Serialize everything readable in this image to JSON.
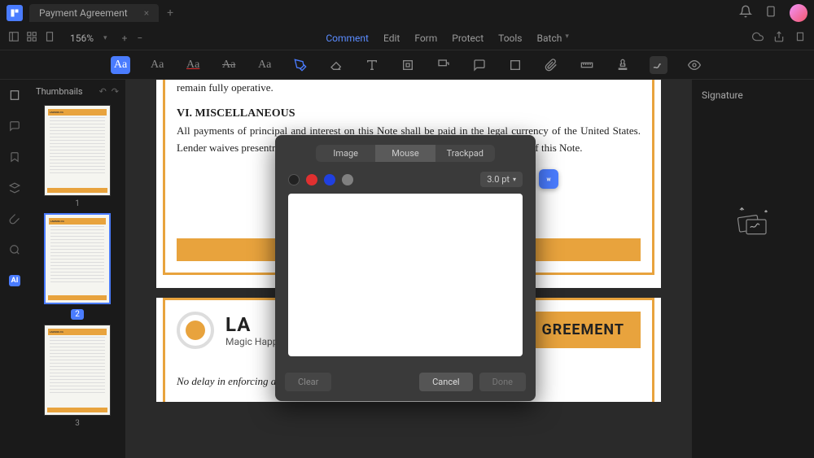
{
  "titlebar": {
    "tab_title": "Payment Agreement"
  },
  "toolbar": {
    "zoom": "156%",
    "menu": [
      "Comment",
      "Edit",
      "Form",
      "Protect",
      "Tools",
      "Batch"
    ],
    "active_menu": 0
  },
  "textStyles": {
    "highlight": "Aa",
    "regular": "Aa",
    "underline": "Aa",
    "strike": "Aa",
    "squiggle": "Aa"
  },
  "thumbs": {
    "title": "Thumbnails",
    "pages": [
      "1",
      "2",
      "3"
    ],
    "selected": 1
  },
  "document": {
    "page1": {
      "line1": "remain fully operative.",
      "heading": "VI. MISCELLANEOUS",
      "para": "All payments of principal and interest on this Note shall be paid in the legal currency of the United States. Lender waives presentment for payment, protest, and notice of protest and demand of this Note."
    },
    "page2": {
      "brand": "LARANA, INC.",
      "brand_partial": "LA",
      "tagline": "Magic Happens With Content",
      "title": "PAYMENT AGREEMENT",
      "title_partial": "GREEMENT",
      "body1": "No delay in enforcing any right of the Lender under this Note, or assignment by"
    }
  },
  "rightPanel": {
    "title": "Signature"
  },
  "modal": {
    "tabs": [
      "Image",
      "Mouse",
      "Trackpad"
    ],
    "active_tab": 1,
    "colors": [
      "#222222",
      "#e03030",
      "#2040e0",
      "#808080"
    ],
    "stroke": "3.0 pt",
    "clear": "Clear",
    "cancel": "Cancel",
    "done": "Done"
  }
}
